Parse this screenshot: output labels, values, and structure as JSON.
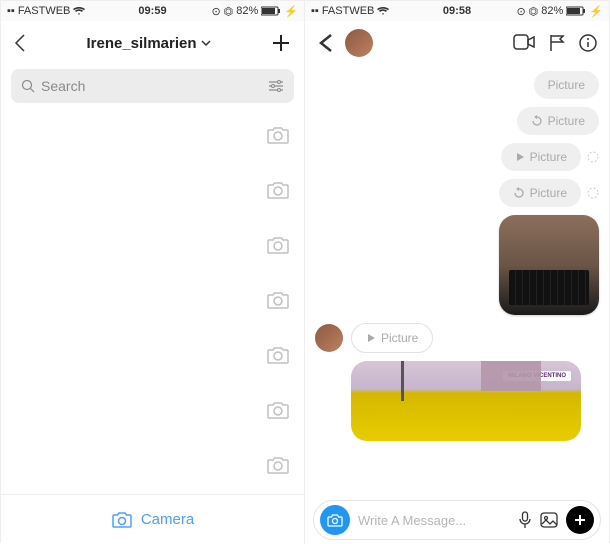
{
  "left": {
    "status": {
      "carrier": "FASTWEB",
      "time": "09:59",
      "battery": "82%"
    },
    "header": {
      "username": "Irene_silmarien"
    },
    "search": {
      "placeholder": "Search"
    },
    "conversations": [
      {},
      {},
      {},
      {},
      {},
      {},
      {}
    ],
    "bottom": {
      "camera_label": "Camera"
    }
  },
  "right": {
    "status": {
      "carrier": "FASTWEB",
      "time": "09:58",
      "battery": "82%"
    },
    "bubbles": [
      {
        "label": "Picture",
        "icon": null,
        "loading": false
      },
      {
        "label": "Picture",
        "icon": "replay",
        "loading": false
      },
      {
        "label": "Picture",
        "icon": "play",
        "loading": true
      },
      {
        "label": "Picture",
        "icon": "replay",
        "loading": true
      }
    ],
    "incoming_bubble": {
      "label": "Picture",
      "icon": "play"
    },
    "location_tag": "MILANO VICENTINO",
    "compose": {
      "placeholder": "Write A Message..."
    }
  }
}
